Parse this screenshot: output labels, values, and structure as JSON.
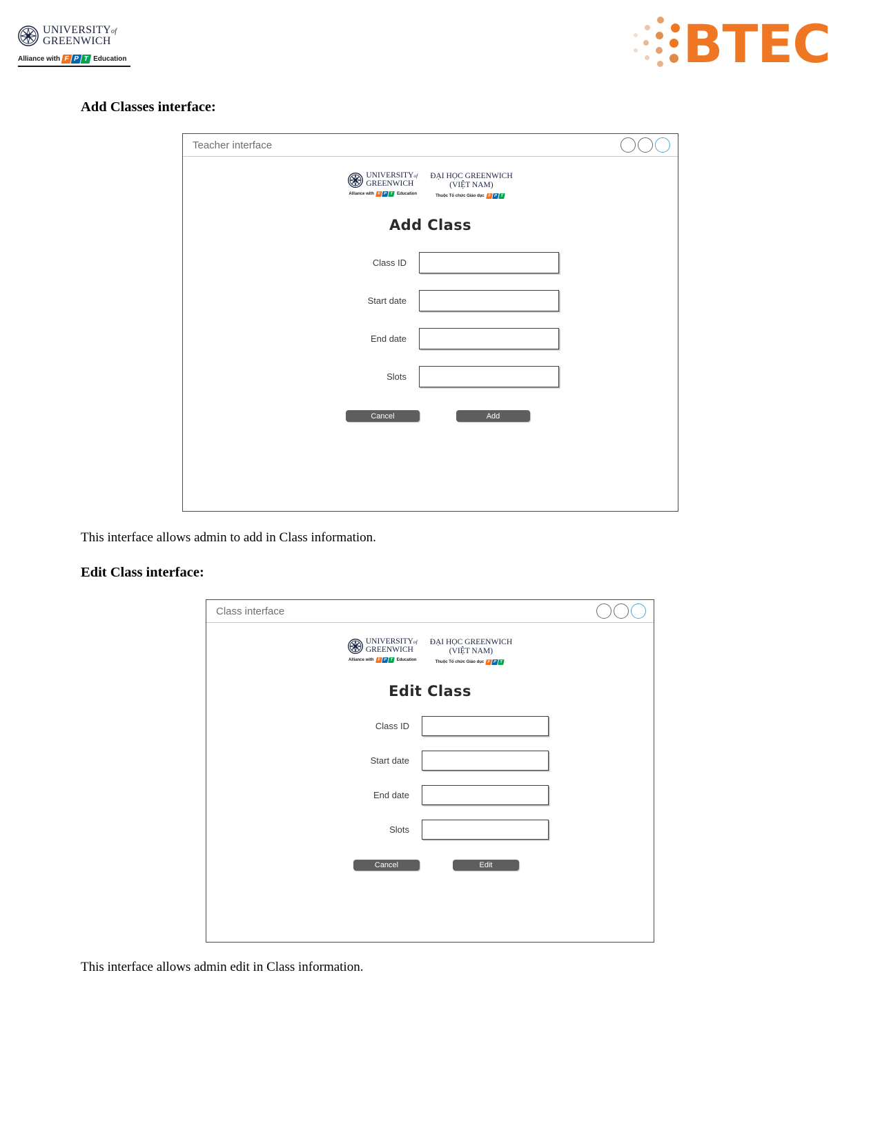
{
  "header": {
    "university": {
      "line1": "UNIVERSITY",
      "line1_small": "of",
      "line2": "GREENWICH",
      "alliance_prefix": "Alliance with",
      "alliance_suffix": "Education",
      "fpt": [
        "F",
        "P",
        "T"
      ]
    },
    "btec": {
      "wordmark": "BTEC",
      "color": "#ef7622"
    }
  },
  "sections": [
    {
      "heading": "Add Classes interface:",
      "caption": "This interface allows admin to add in Class information.",
      "window": {
        "titlebar_text": "Teacher interface",
        "circles": [
          "plain",
          "plain",
          "accent"
        ],
        "logos": {
          "uog_line1": "UNIVERSITY",
          "uog_line1_small": "of",
          "uog_line2": "GREENWICH",
          "uog_alliance_prefix": "Alliance with",
          "uog_alliance_suffix": "Education",
          "vn_line1": "ĐẠI HỌC GREENWICH",
          "vn_line2": "(VIỆT NAM)",
          "vn_sub": "Thuộc Tổ chức Giáo dục"
        },
        "form_title": "Add Class",
        "fields": [
          {
            "label": "Class ID",
            "value": "",
            "placeholder": ""
          },
          {
            "label": "Start date",
            "value": "",
            "placeholder": ""
          },
          {
            "label": "End date",
            "value": "",
            "placeholder": ""
          },
          {
            "label": "Slots",
            "value": "",
            "placeholder": ""
          }
        ],
        "buttons": [
          {
            "label": "Cancel",
            "name": "cancel-button"
          },
          {
            "label": "Add",
            "name": "add-button"
          }
        ]
      }
    },
    {
      "heading": "Edit Class interface:",
      "caption": "This interface allows admin edit in Class information.",
      "window": {
        "titlebar_text": "Class interface",
        "circles": [
          "plain",
          "plain",
          "accent"
        ],
        "logos": {
          "uog_line1": "UNIVERSITY",
          "uog_line1_small": "of",
          "uog_line2": "GREENWICH",
          "uog_alliance_prefix": "Alliance with",
          "uog_alliance_suffix": "Education",
          "vn_line1": "ĐẠI HỌC GREENWICH",
          "vn_line2": "(VIỆT NAM)",
          "vn_sub": "Thuộc Tổ chức Giáo dục"
        },
        "form_title": "Edit Class",
        "fields": [
          {
            "label": "Class ID",
            "value": "",
            "placeholder": ""
          },
          {
            "label": "Start date",
            "value": "",
            "placeholder": ""
          },
          {
            "label": "End date",
            "value": "",
            "placeholder": ""
          },
          {
            "label": "Slots",
            "value": "",
            "placeholder": ""
          }
        ],
        "buttons": [
          {
            "label": "Cancel",
            "name": "cancel-button"
          },
          {
            "label": "Edit",
            "name": "edit-button"
          }
        ]
      }
    }
  ]
}
